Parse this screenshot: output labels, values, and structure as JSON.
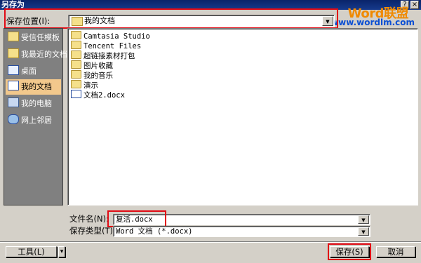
{
  "window": {
    "title": "另存为"
  },
  "watermark": {
    "line1": "Word联盟",
    "line2": "www.wordlm.com"
  },
  "save_in": {
    "label": "保存位置(I):",
    "value": "我的文档"
  },
  "places": [
    {
      "label": "受信任模板",
      "icon": "folder-icon"
    },
    {
      "label": "我最近的文档",
      "icon": "recent-documents-icon"
    },
    {
      "label": "桌面",
      "icon": "desktop-icon"
    },
    {
      "label": "我的文档",
      "icon": "my-documents-icon",
      "selected": true
    },
    {
      "label": "我的电脑",
      "icon": "computer-icon"
    },
    {
      "label": "网上邻居",
      "icon": "network-icon"
    }
  ],
  "files": [
    {
      "name": "Camtasia Studio",
      "type": "folder"
    },
    {
      "name": "Tencent Files",
      "type": "folder"
    },
    {
      "name": "超链接素材打包",
      "type": "folder"
    },
    {
      "name": "图片收藏",
      "type": "folder"
    },
    {
      "name": "我的音乐",
      "type": "folder"
    },
    {
      "name": "演示",
      "type": "folder"
    },
    {
      "name": "文档2.docx",
      "type": "docx"
    }
  ],
  "filename": {
    "label": "文件名(N):",
    "value": "复活.docx"
  },
  "filetype": {
    "label": "保存类型(T):",
    "value": "Word 文档 (*.docx)"
  },
  "buttons": {
    "tools": "工具(L)",
    "save": "保存(S)",
    "cancel": "取消"
  }
}
